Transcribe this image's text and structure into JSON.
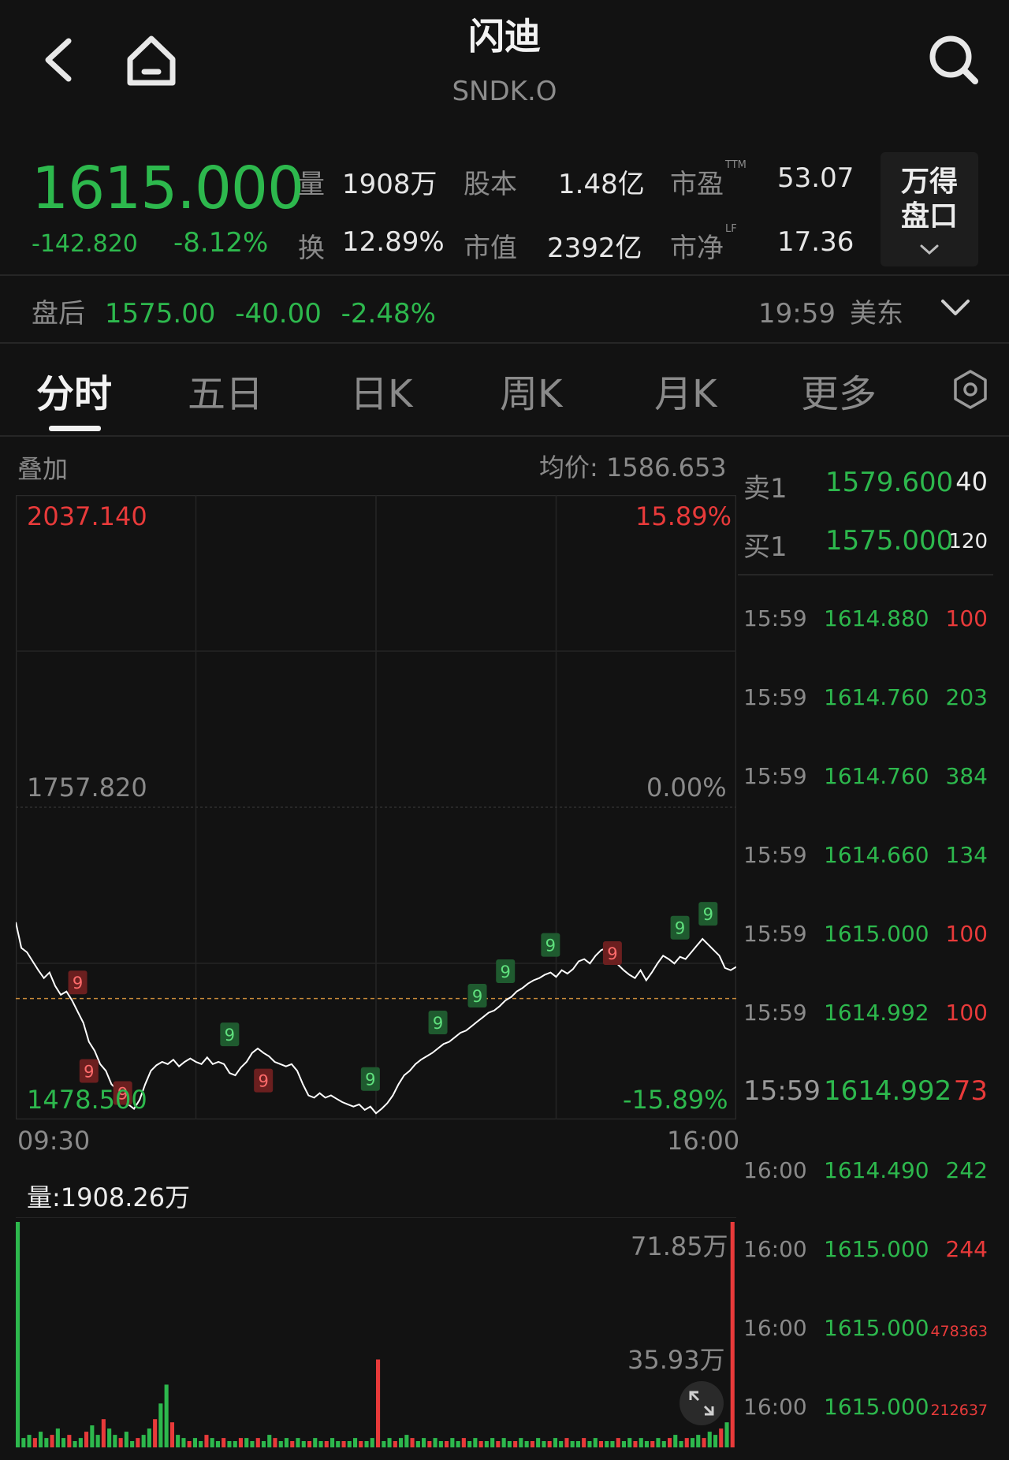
{
  "header": {
    "title": "闪迪",
    "ticker": "SNDK.O",
    "icons": {
      "back": "back-chevron-icon",
      "home": "home-icon",
      "search": "search-icon"
    }
  },
  "quote": {
    "price": "1615.000",
    "change": "-142.820",
    "change_pct": "-8.12%",
    "metrics": [
      {
        "label": "量",
        "value": "1908万"
      },
      {
        "label": "股本",
        "value": "1.48亿"
      },
      {
        "label": "市盈",
        "sup": "TTM",
        "value": "53.07"
      },
      {
        "label": "换",
        "value": "12.89%"
      },
      {
        "label": "市值",
        "value": "2392亿"
      },
      {
        "label": "市净",
        "sup": "LF",
        "value": "17.36"
      }
    ],
    "wind_button": "万得\n盘口"
  },
  "after_hours": {
    "label": "盘后",
    "price": "1575.00",
    "change": "-40.00",
    "change_pct": "-2.48%",
    "time": "19:59",
    "zone": "美东"
  },
  "tabs": [
    "分时",
    "五日",
    "日K",
    "周K",
    "月K",
    "更多"
  ],
  "active_tab": 0,
  "chart": {
    "overlay_label": "叠加",
    "avg_label": "均价:",
    "avg_value": "1586.653",
    "y_top": "2037.140",
    "y_mid": "1757.820",
    "y_bottom": "1478.500",
    "pct_top": "15.89%",
    "pct_mid": "0.00%",
    "pct_bottom": "-15.89%",
    "time_start": "09:30",
    "time_end": "16:00",
    "volume_label": "量:1908.26万",
    "vol_top": "71.85万",
    "vol_mid": "35.93万",
    "marker_text": "9",
    "colors": {
      "up": "#2db84d",
      "down": "#e83a3a",
      "line": "#ffffff",
      "ref": "#c98a3a"
    }
  },
  "chart_data": {
    "type": "line",
    "title": "",
    "xlabel": "",
    "ylabel": "",
    "x_range": [
      "09:30",
      "16:00"
    ],
    "ylim": [
      1478.5,
      2037.14
    ],
    "reference_price": 1757.82,
    "average_price": 1586.653,
    "series": [
      {
        "values": [
          1655,
          1632,
          1628,
          1620,
          1612,
          1605,
          1610,
          1598,
          1590,
          1593,
          1585,
          1575,
          1565,
          1548,
          1540,
          1528,
          1522,
          1510,
          1505,
          1500,
          1492,
          1488,
          1496,
          1510,
          1522,
          1527,
          1530,
          1528,
          1532,
          1526,
          1530,
          1533,
          1530,
          1528,
          1534,
          1528,
          1530,
          1528,
          1520,
          1518,
          1525,
          1530,
          1538,
          1542,
          1538,
          1535,
          1530,
          1528,
          1526,
          1528,
          1522,
          1510,
          1500,
          1498,
          1502,
          1498,
          1500,
          1497,
          1494,
          1492,
          1490,
          1492,
          1487,
          1490,
          1484,
          1488,
          1493,
          1500,
          1510,
          1518,
          1522,
          1528,
          1532,
          1535,
          1538,
          1542,
          1546,
          1548,
          1552,
          1556,
          1558,
          1562,
          1566,
          1570,
          1574,
          1576,
          1580,
          1585,
          1588,
          1593,
          1596,
          1600,
          1603,
          1605,
          1608,
          1610,
          1606,
          1612,
          1609,
          1613,
          1620,
          1622,
          1618,
          1625,
          1630,
          1632,
          1628,
          1617,
          1612,
          1608,
          1605,
          1612,
          1603,
          1610,
          1618,
          1625,
          1622,
          1618,
          1624,
          1622,
          1628,
          1634,
          1640,
          1635,
          1630,
          1625,
          1614,
          1612,
          1615
        ]
      }
    ],
    "volume": [
      71.85,
      3,
      4,
      3,
      5,
      3,
      4,
      6,
      3,
      4,
      2,
      3,
      5,
      7,
      4,
      9,
      6,
      4,
      3,
      5,
      2,
      3,
      4,
      6,
      9,
      14,
      20,
      8,
      4,
      3,
      2,
      3,
      2,
      4,
      3,
      2,
      3,
      2,
      2,
      3,
      3,
      2,
      3,
      2,
      4,
      3,
      2,
      3,
      2,
      3,
      2,
      2,
      3,
      2,
      2,
      3,
      2,
      2,
      2,
      3,
      2,
      2,
      3,
      28,
      2,
      3,
      2,
      3,
      4,
      3,
      2,
      3,
      2,
      3,
      2,
      2,
      3,
      2,
      3,
      2,
      3,
      2,
      2,
      3,
      2,
      3,
      2,
      2,
      3,
      2,
      2,
      3,
      2,
      2,
      3,
      2,
      3,
      2,
      2,
      3,
      2,
      3,
      2,
      2,
      2,
      3,
      2,
      3,
      2,
      3,
      2,
      2,
      3,
      2,
      3,
      4,
      2,
      3,
      3,
      4,
      3,
      5,
      4,
      6,
      8,
      71.85
    ],
    "volume_ylim": [
      0,
      71.85
    ]
  },
  "order_book": {
    "asks": [
      {
        "label": "卖1",
        "price": "1579.600",
        "vol": "40"
      }
    ],
    "bids": [
      {
        "label": "买1",
        "price": "1575.000",
        "vol": "120"
      }
    ]
  },
  "trades": [
    {
      "time": "15:59",
      "price": "1614.880",
      "vol": "100",
      "side": "down"
    },
    {
      "time": "15:59",
      "price": "1614.760",
      "vol": "203",
      "side": "up"
    },
    {
      "time": "15:59",
      "price": "1614.760",
      "vol": "384",
      "side": "up"
    },
    {
      "time": "15:59",
      "price": "1614.660",
      "vol": "134",
      "side": "up"
    },
    {
      "time": "15:59",
      "price": "1615.000",
      "vol": "100",
      "side": "down"
    },
    {
      "time": "15:59",
      "price": "1614.992",
      "vol": "100",
      "side": "down"
    },
    {
      "time": "15:59",
      "price": "1614.992",
      "vol": "73",
      "side": "down"
    },
    {
      "time": "16:00",
      "price": "1614.490",
      "vol": "242",
      "side": "up"
    },
    {
      "time": "16:00",
      "price": "1615.000",
      "vol": "244",
      "side": "down"
    },
    {
      "time": "16:00",
      "price": "1615.000",
      "vol": "478363",
      "side": "down"
    },
    {
      "time": "16:00",
      "price": "1615.000",
      "vol": "212637",
      "side": "down"
    }
  ]
}
